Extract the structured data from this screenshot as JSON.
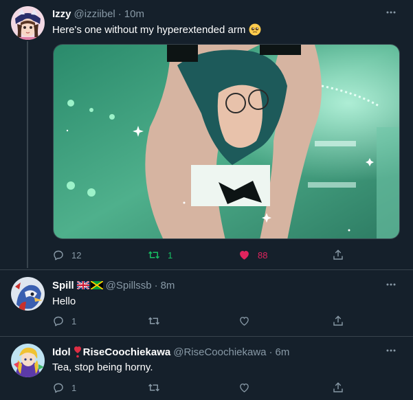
{
  "tweets": [
    {
      "name": "Izzy",
      "handle": "@izziibel",
      "separator": "·",
      "time": "10m",
      "text": "Here's one without my hyperextended arm",
      "emoji_icon": "pleading-face-emoji",
      "media_description_icon": "photo",
      "actions": {
        "reply_count": "12",
        "retweet_count": "1",
        "like_count": "88",
        "retweeted": true,
        "liked": true
      }
    },
    {
      "name": "Spill",
      "name_flags": [
        "uk-flag-icon",
        "jamaica-flag-icon"
      ],
      "handle": "@Spillssb",
      "separator": "·",
      "time": "8m",
      "text": "Hello",
      "actions": {
        "reply_count": "1",
        "retweet_count": "",
        "like_count": ""
      }
    },
    {
      "name": "Idol",
      "name_suffix": "RiseCoochiekawa",
      "name_emoji": "red-heart-exclamation-icon",
      "handle": "@RiseCoochiekawa",
      "separator": "·",
      "time": "6m",
      "text": "Tea, stop being horny.",
      "actions": {
        "reply_count": "1",
        "retweet_count": "",
        "like_count": ""
      }
    }
  ],
  "colors": {
    "background": "#15202b",
    "text_primary": "#ffffff",
    "text_secondary": "#8899a6",
    "border": "#38444d",
    "retweet_active": "#17bf63",
    "like_active": "#e0245e"
  }
}
